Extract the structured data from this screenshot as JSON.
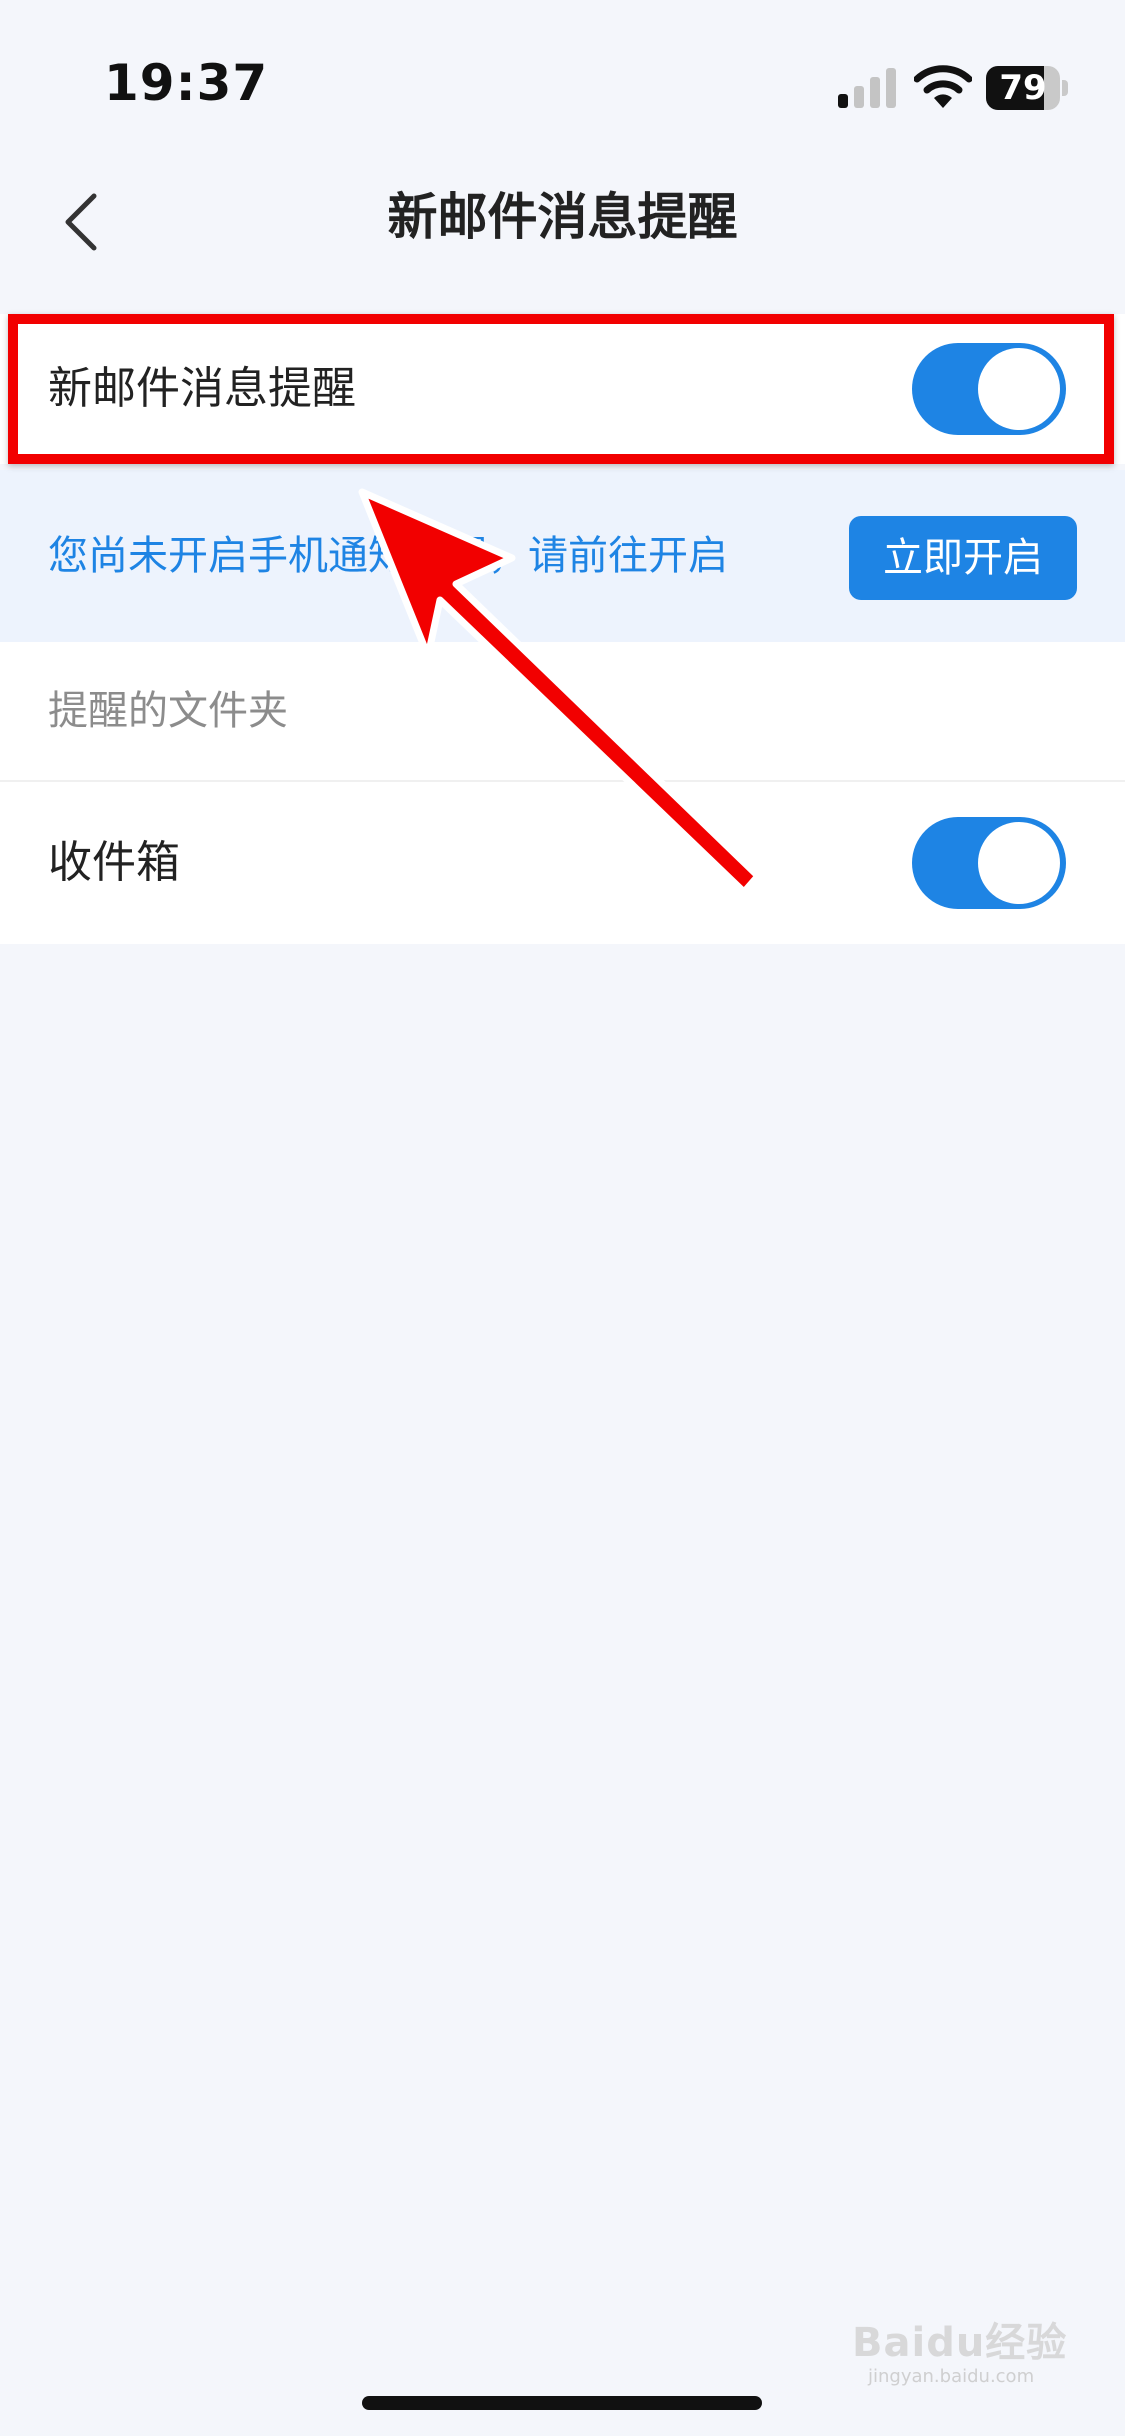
{
  "status_bar": {
    "time": "19:37",
    "battery_percent": "79",
    "battery_level": 0.79,
    "signal_icon": "cellular-signal-icon",
    "wifi_icon": "wifi-icon"
  },
  "nav": {
    "title": "新邮件消息提醒",
    "back_icon": "chevron-left-icon"
  },
  "settings": {
    "new_mail_alert": {
      "label": "新邮件消息提醒",
      "enabled": true
    },
    "notice": {
      "text": "您尚未开启手机通知设置，请前往开启",
      "button_label": "立即开启"
    },
    "folder_section": {
      "header": "提醒的文件夹",
      "items": [
        {
          "label": "收件箱",
          "enabled": true
        }
      ]
    }
  },
  "annotations": {
    "highlight_color": "#f20000",
    "arrow_color": "#f20000"
  },
  "watermark": {
    "main": "Baidu经验",
    "sub": "jingyan.baidu.com"
  },
  "colors": {
    "accent": "#1e84e4",
    "background": "#f4f6fb",
    "notice_background": "#edf3fd"
  }
}
